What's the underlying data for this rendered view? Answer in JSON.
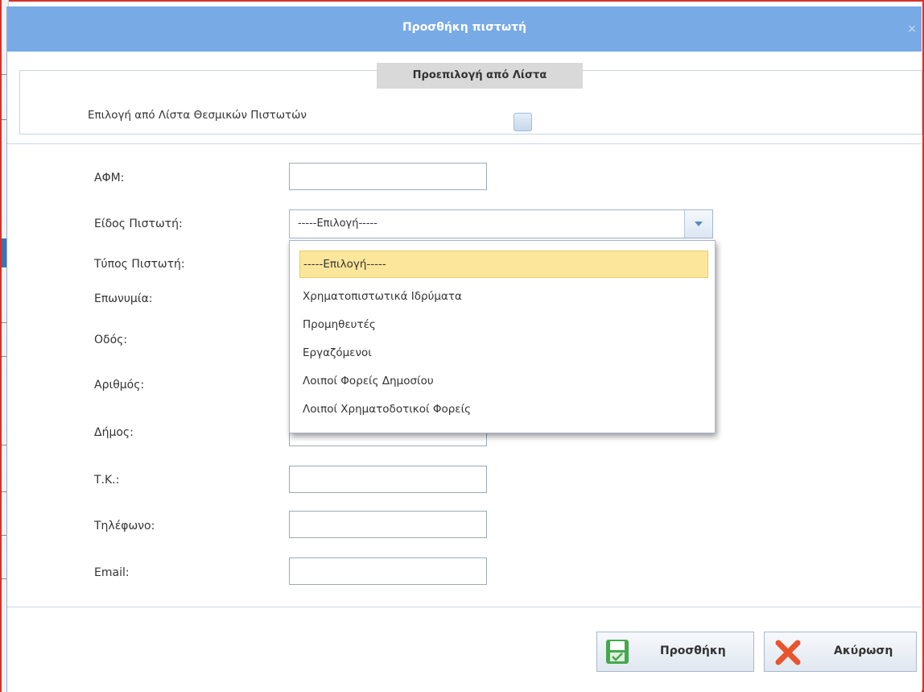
{
  "dialog": {
    "title": "Προσθήκη πιστωτή",
    "close_glyph": "×"
  },
  "preset": {
    "tab_label": "Προεπιλογή από Λίστα",
    "checkbox_label": "Επιλογή από Λίστα Θεσμικών Πιστωτών",
    "checked": false
  },
  "form": {
    "afm_label": "ΑΦΜ:",
    "creditor_kind_label": "Είδος Πιστωτή:",
    "creditor_type_label": "Τύπος Πιστωτή:",
    "name_label": "Επωνυμία:",
    "street_label": "Οδός:",
    "number_label": "Αριθμός:",
    "municipality_label": "Δήμος:",
    "postal_label": "Τ.Κ.:",
    "phone_label": "Τηλέφωνο:",
    "email_label": "Email:"
  },
  "creditor_kind_select": {
    "value": "-----Επιλογή-----",
    "options": [
      "-----Επιλογή-----",
      "Χρηματοπιστωτικά Ιδρύματα",
      "Προμηθευτές",
      "Εργαζόμενοι",
      "Λοιποί Φορείς Δημοσίου",
      "Λοιποί Χρηματοδοτικοί Φορείς"
    ]
  },
  "buttons": {
    "add_label": "Προσθήκη",
    "cancel_label": "Ακύρωση"
  },
  "colors": {
    "titlebar": "#78aae6",
    "selected_option": "#fbe69b",
    "frame": "#d9302a",
    "cancel_icon": "#e8542e",
    "save_icon": "#45a84d"
  },
  "icons": {
    "add_button_icon": "save-icon",
    "cancel_button_icon": "cancel-x-icon",
    "select_arrow_icon": "chevron-down-icon"
  }
}
